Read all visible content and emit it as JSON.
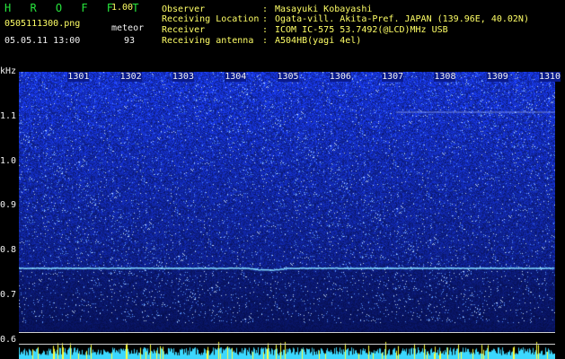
{
  "header": {
    "app_title": "H R O F F T",
    "app_version": "1.00",
    "file_name": "0505111300.png",
    "date_time": "05.05.11 13:00",
    "meteor_label": "meteor",
    "meteor_count": "93"
  },
  "info": [
    {
      "label": "Observer",
      "value": "Masayuki Kobayashi"
    },
    {
      "label": "Receiving Location",
      "value": "Ogata-vill. Akita-Pref. JAPAN (139.96E, 40.02N)"
    },
    {
      "label": "Receiver",
      "value": "ICOM IC-575 53.7492(@LCD)MHz USB"
    },
    {
      "label": "Receiving antenna",
      "value": "A504HB(yagi 4el)"
    }
  ],
  "colon": ":",
  "chart_data": {
    "type": "heatmap",
    "ylabel": "kHz",
    "y_ticks": [
      "1.1",
      "1.0",
      "0.9",
      "0.8",
      "0.7",
      "0.6"
    ],
    "x_ticks": [
      "1301",
      "1302",
      "1303",
      "1304",
      "1305",
      "1306",
      "1307",
      "1308",
      "1309",
      "1310"
    ],
    "x_range": [
      1300,
      1310
    ],
    "y_range": [
      0.6,
      1.16
    ],
    "carrier_line_khz": 0.76,
    "colors": {
      "background": "#000000",
      "noise_low": "#0a1a6e",
      "noise_high": "#3a6cff",
      "speck": "#cfe4ff",
      "carrier": "#7fd6ff",
      "activity_bars": "#3cd8ff",
      "meteor_spikes": "#ffff3c",
      "header_green": "#27e43c",
      "header_yellow": "#ffff66"
    }
  }
}
